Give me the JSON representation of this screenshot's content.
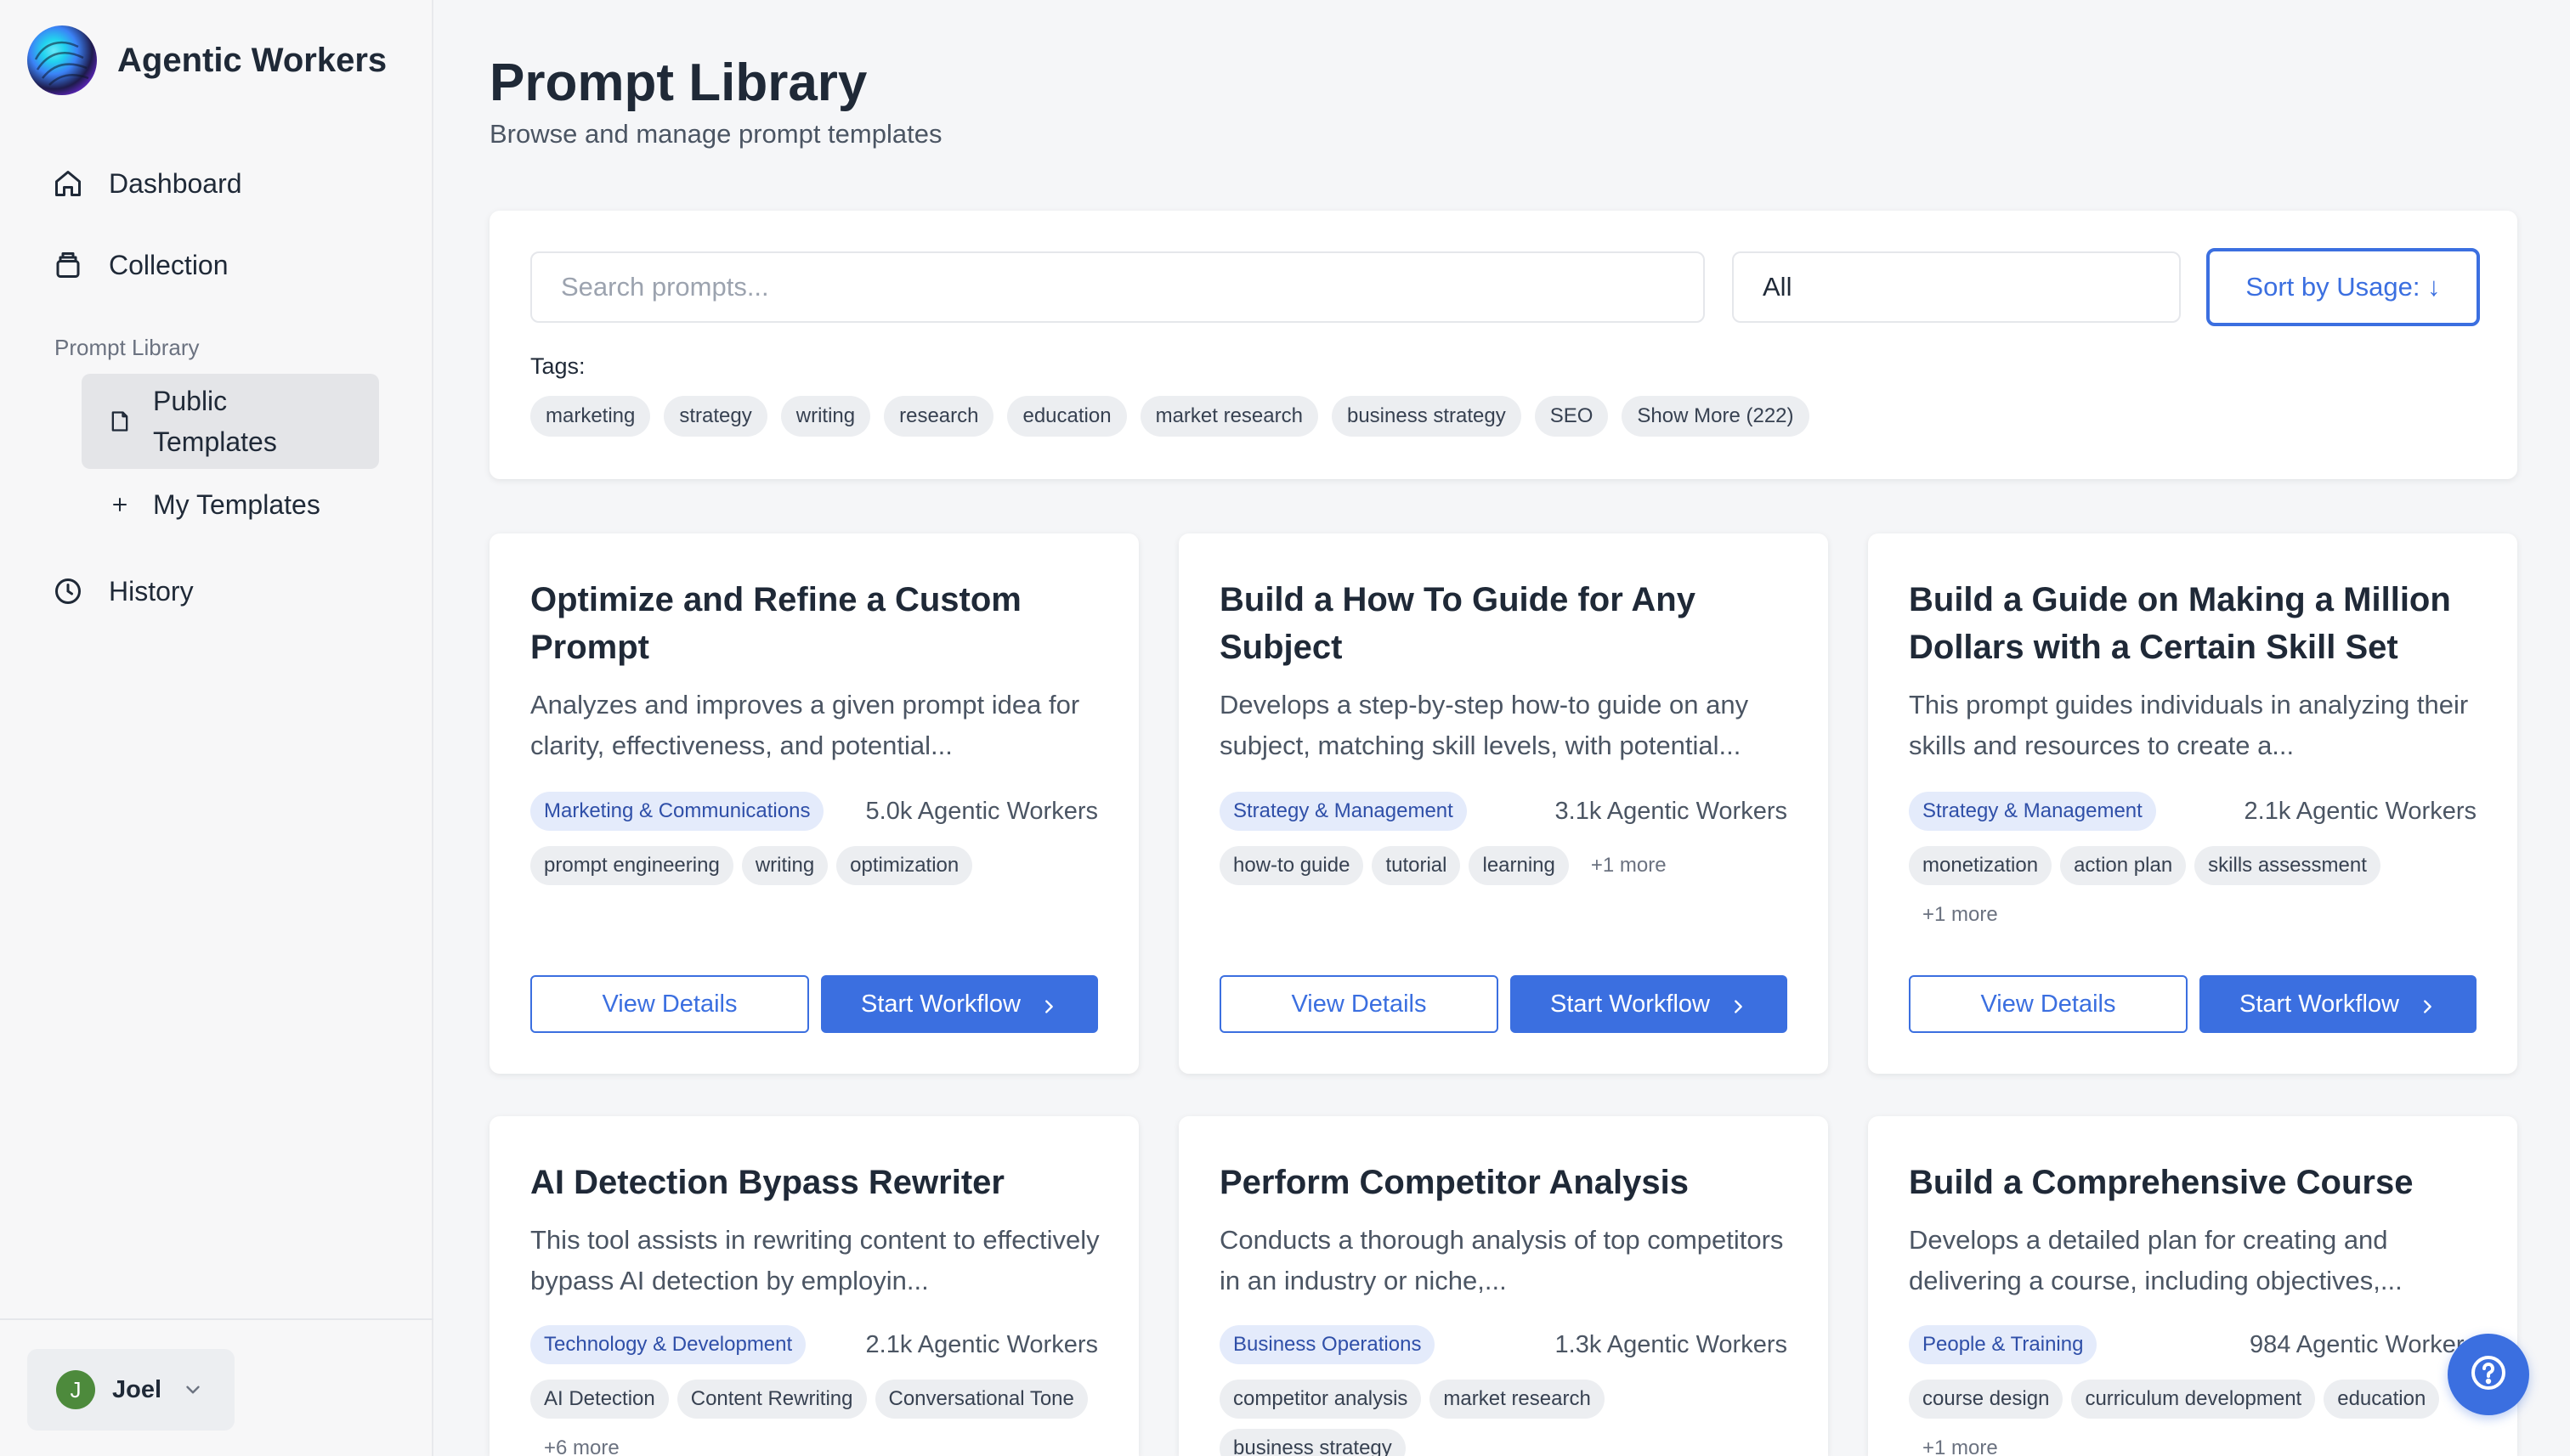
{
  "colors": {
    "accent": "#3b6fe0",
    "badge_bg": "#e4ebfb",
    "badge_text": "#2f4fa8",
    "tag_bg": "#eceef1",
    "avatar_bg": "#4d8a3c"
  },
  "brand": {
    "name": "Agentic Workers"
  },
  "sidebar": {
    "dashboard": "Dashboard",
    "collection": "Collection",
    "section_label": "Prompt Library",
    "public_templates": "Public Templates",
    "my_templates": "My Templates",
    "history": "History"
  },
  "user": {
    "initial": "J",
    "name": "Joel"
  },
  "page": {
    "title": "Prompt Library",
    "subtitle": "Browse and manage prompt templates"
  },
  "filters": {
    "search_placeholder": "Search prompts...",
    "category_value": "All",
    "sort_label": "Sort by Usage: ↓",
    "tags_label": "Tags:",
    "tags": [
      "marketing",
      "strategy",
      "writing",
      "research",
      "education",
      "market research",
      "business strategy",
      "SEO"
    ],
    "show_more": "Show More (222)"
  },
  "actions": {
    "view_details": "View Details",
    "start_workflow": "Start Workflow"
  },
  "cards": [
    {
      "title": "Optimize and Refine a Custom Prompt",
      "description": "Analyzes and improves a given prompt idea for clarity, effectiveness, and potential...",
      "category": "Marketing & Communications",
      "usage": "5.0k Agentic Workers",
      "tags": [
        "prompt engineering",
        "writing",
        "optimization"
      ],
      "more": ""
    },
    {
      "title": "Build a How To Guide for Any Subject",
      "description": "Develops a step-by-step how-to guide on any subject, matching skill levels, with potential...",
      "category": "Strategy & Management",
      "usage": "3.1k Agentic Workers",
      "tags": [
        "how-to guide",
        "tutorial",
        "learning"
      ],
      "more": "+1 more"
    },
    {
      "title": "Build a Guide on Making a Million Dollars with a Certain Skill Set",
      "description": "This prompt guides individuals in analyzing their skills and resources to create a...",
      "category": "Strategy & Management",
      "usage": "2.1k Agentic Workers",
      "tags": [
        "monetization",
        "action plan",
        "skills assessment"
      ],
      "more": "+1 more"
    },
    {
      "title": "AI Detection Bypass Rewriter",
      "description": "This tool assists in rewriting content to effectively bypass AI detection by employin...",
      "category": "Technology & Development",
      "usage": "2.1k Agentic Workers",
      "tags": [
        "AI Detection",
        "Content Rewriting",
        "Conversational Tone"
      ],
      "more": "+6 more"
    },
    {
      "title": "Perform Competitor Analysis",
      "description": "Conducts a thorough analysis of top competitors in an industry or niche,...",
      "category": "Business Operations",
      "usage": "1.3k Agentic Workers",
      "tags": [
        "competitor analysis",
        "market research",
        "business strategy"
      ],
      "more": ""
    },
    {
      "title": "Build a Comprehensive Course",
      "description": "Develops a detailed plan for creating and delivering a course, including objectives,...",
      "category": "People & Training",
      "usage": "984 Agentic Workers",
      "tags": [
        "course design",
        "curriculum development",
        "education"
      ],
      "more": "+1 more"
    }
  ]
}
